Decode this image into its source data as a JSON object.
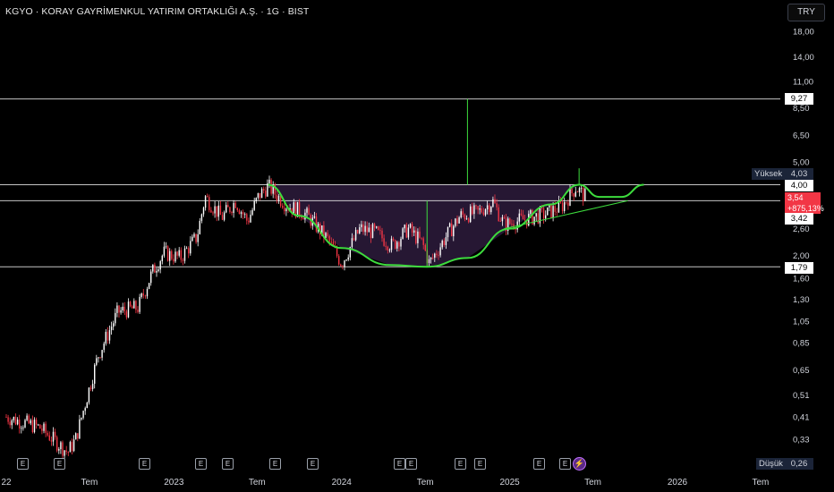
{
  "header": {
    "title": "KGYO · KORAY GAYRİMENKUL YATIRIM ORTAKLIĞI A.Ş. · 1G · BIST",
    "currency_button": "TRY"
  },
  "colors": {
    "up": "#ffffff",
    "down": "#f23645",
    "pattern_curve": "#3ddc3d",
    "cup_fill": "#2a1a38",
    "hline": "#e8e8e8",
    "last_price_bg": "#f23645",
    "axis_text": "#d1d4dc"
  },
  "price_axis": {
    "scale": "log",
    "ticks": [
      "18,00",
      "14,00",
      "11,00",
      "8,50",
      "6,50",
      "5,00",
      "2,60",
      "2,00",
      "1,60",
      "1,30",
      "1,05",
      "0,85",
      "0,65",
      "0,51",
      "0,41",
      "0,33"
    ],
    "yuksek_label": "Yüksek",
    "yuksek_value": "4,03",
    "dusuk_label": "Düşük",
    "dusuk_value": "0,26",
    "level_labels": {
      "l927": "9,27",
      "l400": "4,00",
      "l342": "3,42",
      "l179": "1,79"
    },
    "last_price": "3,54",
    "last_change": "+875,13%"
  },
  "time_axis": {
    "ticks": [
      "22",
      "Tem",
      "2023",
      "Tem",
      "2024",
      "Tem",
      "2025",
      "Tem",
      "2026",
      "Tem"
    ]
  },
  "events": [
    "E",
    "E",
    "E",
    "E",
    "E",
    "E",
    "E",
    "E",
    "E",
    "E",
    "E",
    "E",
    "E",
    "E"
  ],
  "chart_data": {
    "type": "candlestick",
    "title": "KGYO · KORAY GAYRİMENKUL YATIRIM ORTAKLIĞI A.Ş. · 1G · BIST",
    "y_scale": "log",
    "ylim": [
      0.26,
      20
    ],
    "x_range": [
      "2022-01",
      "2026-09"
    ],
    "horizontal_levels": [
      9.27,
      4.0,
      3.42,
      1.79
    ],
    "price_path": [
      {
        "date": "2022-01-01",
        "price": 0.41
      },
      {
        "date": "2022-03-15",
        "price": 0.37
      },
      {
        "date": "2022-05-15",
        "price": 0.29
      },
      {
        "date": "2022-06-01",
        "price": 0.33
      },
      {
        "date": "2022-07-20",
        "price": 0.75
      },
      {
        "date": "2022-09-01",
        "price": 1.15
      },
      {
        "date": "2022-10-15",
        "price": 1.2
      },
      {
        "date": "2022-11-15",
        "price": 1.7
      },
      {
        "date": "2022-12-10",
        "price": 2.05
      },
      {
        "date": "2023-01-15",
        "price": 1.95
      },
      {
        "date": "2023-02-20",
        "price": 2.4
      },
      {
        "date": "2023-03-10",
        "price": 3.55
      },
      {
        "date": "2023-04-15",
        "price": 2.9
      },
      {
        "date": "2023-05-15",
        "price": 3.4
      },
      {
        "date": "2023-06-10",
        "price": 2.8
      },
      {
        "date": "2023-07-05",
        "price": 3.6
      },
      {
        "date": "2023-07-25",
        "price": 3.95
      },
      {
        "date": "2023-09-01",
        "price": 3.3
      },
      {
        "date": "2023-10-15",
        "price": 3.0
      },
      {
        "date": "2023-12-01",
        "price": 2.35
      },
      {
        "date": "2024-01-01",
        "price": 1.85
      },
      {
        "date": "2024-02-10",
        "price": 2.6
      },
      {
        "date": "2024-03-15",
        "price": 2.5
      },
      {
        "date": "2024-04-20",
        "price": 2.2
      },
      {
        "date": "2024-05-25",
        "price": 2.6
      },
      {
        "date": "2024-06-25",
        "price": 2.25
      },
      {
        "date": "2024-07-10",
        "price": 1.85
      },
      {
        "date": "2024-08-15",
        "price": 2.4
      },
      {
        "date": "2024-09-15",
        "price": 2.95
      },
      {
        "date": "2024-10-25",
        "price": 3.05
      },
      {
        "date": "2024-11-25",
        "price": 3.4
      },
      {
        "date": "2024-12-20",
        "price": 2.7
      },
      {
        "date": "2025-02-01",
        "price": 2.85
      },
      {
        "date": "2025-03-20",
        "price": 3.0
      },
      {
        "date": "2025-04-25",
        "price": 3.25
      },
      {
        "date": "2025-05-25",
        "price": 3.9
      },
      {
        "date": "2025-06-15",
        "price": 3.54
      }
    ],
    "cup_curve": [
      {
        "date": "2023-07-25",
        "price": 4.0
      },
      {
        "date": "2023-10-01",
        "price": 2.95
      },
      {
        "date": "2024-01-01",
        "price": 2.15
      },
      {
        "date": "2024-04-15",
        "price": 1.82
      },
      {
        "date": "2024-07-05",
        "price": 1.79
      },
      {
        "date": "2024-10-01",
        "price": 1.95
      },
      {
        "date": "2025-01-01",
        "price": 2.6
      },
      {
        "date": "2025-04-01",
        "price": 3.3
      },
      {
        "date": "2025-06-01",
        "price": 4.0
      }
    ],
    "handle_curve": [
      {
        "date": "2025-06-01",
        "price": 4.0
      },
      {
        "date": "2025-07-15",
        "price": 3.55
      },
      {
        "date": "2025-09-01",
        "price": 3.55
      },
      {
        "date": "2025-10-20",
        "price": 4.0
      }
    ],
    "trend_line": [
      {
        "date": "2024-12-20",
        "price": 2.6
      },
      {
        "date": "2025-09-15",
        "price": 3.42
      }
    ],
    "target_line": [
      {
        "date": "2024-10-01",
        "price": 4.0
      },
      {
        "date": "2024-10-01",
        "price": 9.27
      }
    ]
  }
}
